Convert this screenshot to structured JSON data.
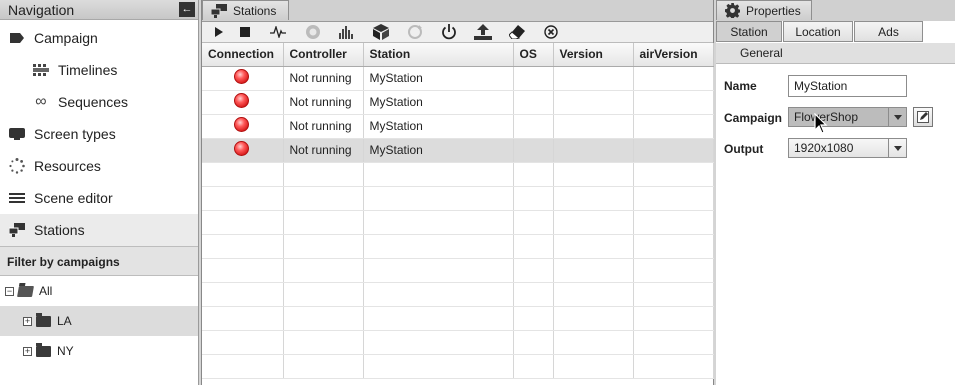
{
  "navigation": {
    "title": "Navigation",
    "items": [
      {
        "label": "Campaign",
        "icon": "tag-icon"
      },
      {
        "label": "Timelines",
        "icon": "timeline-icon"
      },
      {
        "label": "Sequences",
        "icon": "infinity-icon"
      },
      {
        "label": "Screen types",
        "icon": "screen-icon"
      },
      {
        "label": "Resources",
        "icon": "spinner-icon"
      },
      {
        "label": "Scene editor",
        "icon": "scene-editor-icon"
      },
      {
        "label": "Stations",
        "icon": "stations-icon"
      }
    ],
    "filter_title": "Filter by campaigns",
    "tree": {
      "root": "All",
      "children": [
        "LA",
        "NY"
      ]
    }
  },
  "stations": {
    "tab_label": "Stations",
    "toolbar": [
      "play-icon",
      "stop-icon",
      "pulse-icon",
      "record-icon",
      "equalizer-icon",
      "package-icon",
      "refresh-icon",
      "power-icon",
      "upload-icon",
      "eraser-icon",
      "cancel-icon"
    ],
    "columns": [
      "Connection",
      "Controller",
      "Station",
      "OS",
      "Version",
      "airVersion"
    ],
    "rows": [
      {
        "controller": "Not running",
        "station": "MyStation"
      },
      {
        "controller": "Not running",
        "station": "MyStation"
      },
      {
        "controller": "Not running",
        "station": "MyStation"
      },
      {
        "controller": "Not running",
        "station": "MyStation"
      }
    ],
    "status_color": "#e02020"
  },
  "properties": {
    "tab_label": "Properties",
    "tabs": [
      "Station",
      "Location",
      "Ads"
    ],
    "section": "General",
    "name_label": "Name",
    "name_value": "MyStation",
    "campaign_label": "Campaign",
    "campaign_value": "FlowerShop",
    "output_label": "Output",
    "output_value": "1920x1080"
  }
}
